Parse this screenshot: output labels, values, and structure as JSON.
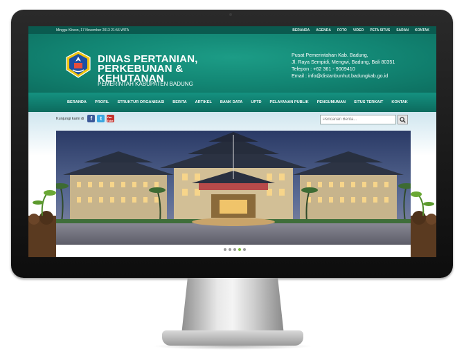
{
  "topbar": {
    "date": "Minggu Kliwon,  17 November 2013 21:56 WITA",
    "links": [
      "BERANDA",
      "AGENDA",
      "FOTO",
      "VIDEO",
      "PETA SITUS",
      "SARAN",
      "KONTAK"
    ]
  },
  "header": {
    "title_line1": "DINAS PERTANIAN,",
    "title_line2": "PERKEBUNAN & KEHUTANAN",
    "subtitle": "PEMERINTAH KABUPATEN BADUNG",
    "contact": [
      "Pusat Pemerintahan Kab. Badung,",
      "Jl. Raya Sempidi, Mengwi, Badung, Bali 80351",
      "Telepon : +62 361 - 9009410",
      "Email : info@distanbunhut.badungkab.go.id"
    ]
  },
  "nav": [
    "BERANDA",
    "PROFIL",
    "STRUKTUR ORGANISASI",
    "BERITA",
    "ARTIKEL",
    "BANK DATA",
    "UPTD",
    "PELAYANAN PUBLIK",
    "PENGUMUMAN",
    "SITUS TERKAIT",
    "KONTAK"
  ],
  "social": {
    "label": "Kunjungi kami di",
    "facebook": "f",
    "twitter": "t",
    "youtube": "You Tube"
  },
  "search": {
    "placeholder": "Pencarian Berita..."
  },
  "slider": {
    "dots": 5,
    "active_dot": 4
  },
  "colors": {
    "topbar": "#0a5a4f",
    "header": "#128573",
    "nav": "#0c6b5e",
    "accent": "#7cbc3c"
  }
}
